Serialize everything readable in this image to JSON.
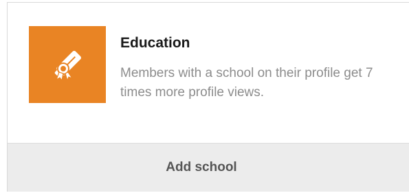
{
  "card": {
    "icon": "diploma-icon",
    "accent_color": "#e98424",
    "title": "Education",
    "description": "Members with a school on their profile get 7 times more profile views.",
    "action_label": "Add school"
  }
}
